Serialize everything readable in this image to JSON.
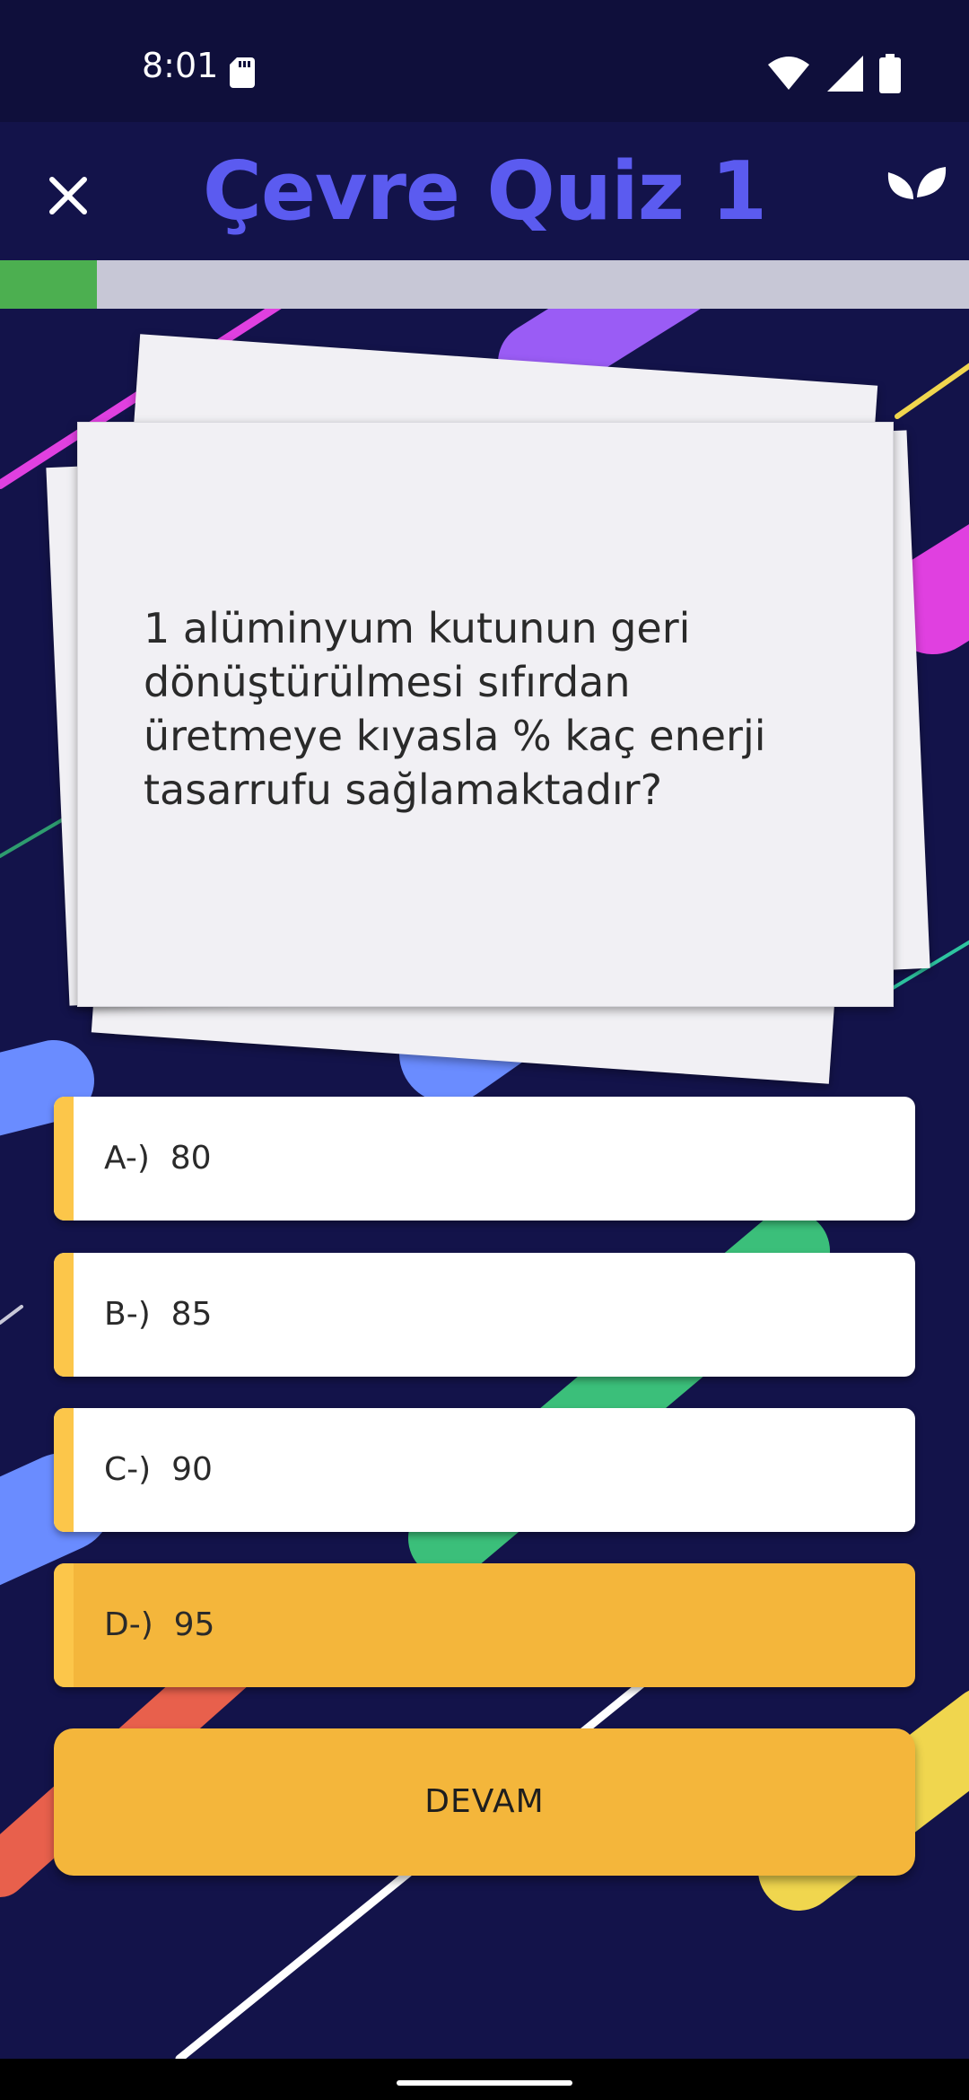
{
  "status_bar": {
    "time": "8:01"
  },
  "app_bar": {
    "title": "Çevre Quiz 1"
  },
  "progress": {
    "fraction": 0.1
  },
  "question": {
    "text": "1 alüminyum kutunun geri dönüştürülmesi sıfırdan üretmeye kıyasla % kaç enerji tasarrufu sağlamaktadır?"
  },
  "answers": [
    {
      "prefix": "A-)",
      "value": "80",
      "selected": false
    },
    {
      "prefix": "B-)",
      "value": "85",
      "selected": false
    },
    {
      "prefix": "C-)",
      "value": "90",
      "selected": false
    },
    {
      "prefix": "D-)",
      "value": "95",
      "selected": true
    }
  ],
  "continue_label": "DEVAM",
  "colors": {
    "background": "#13134a",
    "title": "#5b5bf0",
    "progress_fill": "#4caf50",
    "progress_track": "#c7c7d6",
    "accent": "#f4b63b",
    "answer_stripe": "#fcc64a"
  },
  "icons": {
    "close": "close-icon",
    "sprout": "sprout-icon",
    "sd_card": "sd-card-icon",
    "wifi": "wifi-icon",
    "signal": "signal-icon",
    "battery": "battery-icon"
  }
}
